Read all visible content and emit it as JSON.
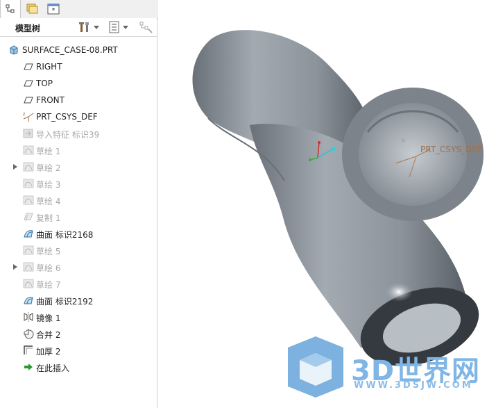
{
  "tabs": [
    {
      "name": "model-tree",
      "icon": "tree-hierarchy-icon"
    },
    {
      "name": "folder-browser",
      "icon": "folders-icon"
    },
    {
      "name": "favorites",
      "icon": "asterisk-window-icon"
    }
  ],
  "toolbar": {
    "title": "模型树",
    "settings_icon": "tools-icon",
    "show_icon": "list-settings-icon",
    "filter_icon": "tree-filter-icon"
  },
  "tree": {
    "root": {
      "label": "SURFACE_CASE-08.PRT",
      "icon": "part-icon"
    },
    "items": [
      {
        "label": "RIGHT",
        "icon": "datum-plane-icon",
        "dim": false,
        "expandable": false
      },
      {
        "label": "TOP",
        "icon": "datum-plane-icon",
        "dim": false,
        "expandable": false
      },
      {
        "label": "FRONT",
        "icon": "datum-plane-icon",
        "dim": false,
        "expandable": false
      },
      {
        "label": "PRT_CSYS_DEF",
        "icon": "csys-icon",
        "dim": false,
        "expandable": false
      },
      {
        "label": "导入特征 标识39",
        "icon": "import-feature-icon",
        "dim": true,
        "expandable": false
      },
      {
        "label": "草绘 1",
        "icon": "sketch-icon",
        "dim": true,
        "expandable": false
      },
      {
        "label": "草绘 2",
        "icon": "sketch-icon",
        "dim": true,
        "expandable": true
      },
      {
        "label": "草绘 3",
        "icon": "sketch-icon",
        "dim": true,
        "expandable": false
      },
      {
        "label": "草绘 4",
        "icon": "sketch-icon",
        "dim": true,
        "expandable": false
      },
      {
        "label": "复制 1",
        "icon": "copy-surface-icon",
        "dim": true,
        "expandable": false
      },
      {
        "label": "曲面 标识2168",
        "icon": "surface-icon",
        "dim": false,
        "expandable": false
      },
      {
        "label": "草绘 5",
        "icon": "sketch-icon",
        "dim": true,
        "expandable": false
      },
      {
        "label": "草绘 6",
        "icon": "sketch-icon",
        "dim": true,
        "expandable": true
      },
      {
        "label": "草绘 7",
        "icon": "sketch-icon",
        "dim": true,
        "expandable": false
      },
      {
        "label": "曲面 标识2192",
        "icon": "surface-icon",
        "dim": false,
        "expandable": false
      },
      {
        "label": "镜像 1",
        "icon": "mirror-icon",
        "dim": false,
        "expandable": false
      },
      {
        "label": "合并 2",
        "icon": "merge-icon",
        "dim": false,
        "expandable": false
      },
      {
        "label": "加厚 2",
        "icon": "thicken-icon",
        "dim": false,
        "expandable": false
      },
      {
        "label": "在此插入",
        "icon": "insert-here-arrow-icon",
        "dim": false,
        "expandable": false
      }
    ]
  },
  "viewport": {
    "csys_label": "PRT_CSYS_DEF",
    "watermark_text": "3D世界网",
    "watermark_url": "WWW.3DSJW.COM"
  },
  "colors": {
    "model_gray": "#8a9199",
    "watermark_blue": "#7fb6e6",
    "csys_label": "#a0704a"
  }
}
